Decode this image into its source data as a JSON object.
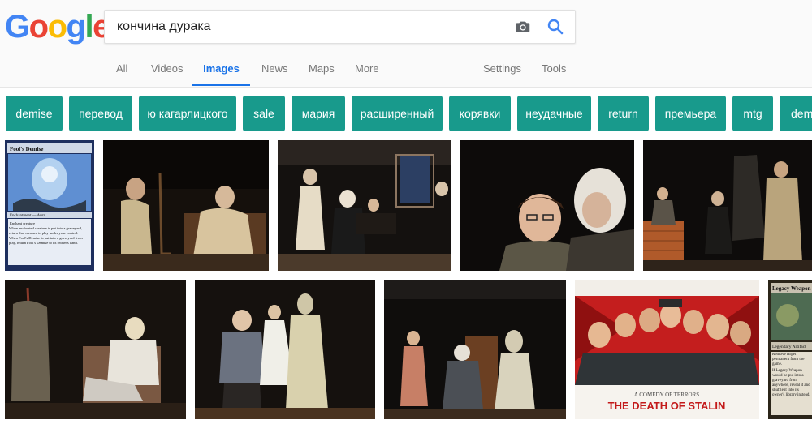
{
  "logo": {
    "letters": [
      "G",
      "o",
      "o",
      "g",
      "l",
      "e"
    ],
    "colors": [
      "#4285f4",
      "#ea4335",
      "#fbbc05",
      "#4285f4",
      "#34a853",
      "#ea4335"
    ]
  },
  "search": {
    "query": "кончина дурака",
    "camera_icon": "camera-icon",
    "search_icon": "search-icon"
  },
  "tabs": [
    {
      "label": "All"
    },
    {
      "label": "Videos"
    },
    {
      "label": "Images",
      "active": true
    },
    {
      "label": "News"
    },
    {
      "label": "Maps"
    },
    {
      "label": "More"
    },
    {
      "label": "Settings"
    },
    {
      "label": "Tools"
    }
  ],
  "chips": [
    "demise",
    "перевод",
    "ю кагарлицкого",
    "sale",
    "мария",
    "расширенный",
    "корявки",
    "неудачные",
    "return",
    "премьера",
    "mtg",
    "dem"
  ],
  "results": {
    "card1": {
      "title": "Fool's Demise",
      "type": "Enchantment — Aura",
      "text1": "Enchant creature",
      "text2": "When enchanted creature is put into a graveyard, return that creature to play under your control.",
      "text3": "When Fool's Demise is put into a graveyard from play, return Fool's Demise to its owner's hand."
    },
    "poster": {
      "subtitle": "A COMEDY OF TERRORS",
      "title": "THE DEATH OF STALIN"
    },
    "card2": {
      "title": "Legacy Weapon",
      "type": "Legendary Artifact",
      "text1": "Remove target permanent from the game.",
      "text2": "If Legacy Weapon would be put into a graveyard from anywhere, reveal it and shuffle it into its owner's library instead."
    }
  },
  "colors": {
    "accent": "#1a73e8",
    "chip": "#189a8c"
  }
}
